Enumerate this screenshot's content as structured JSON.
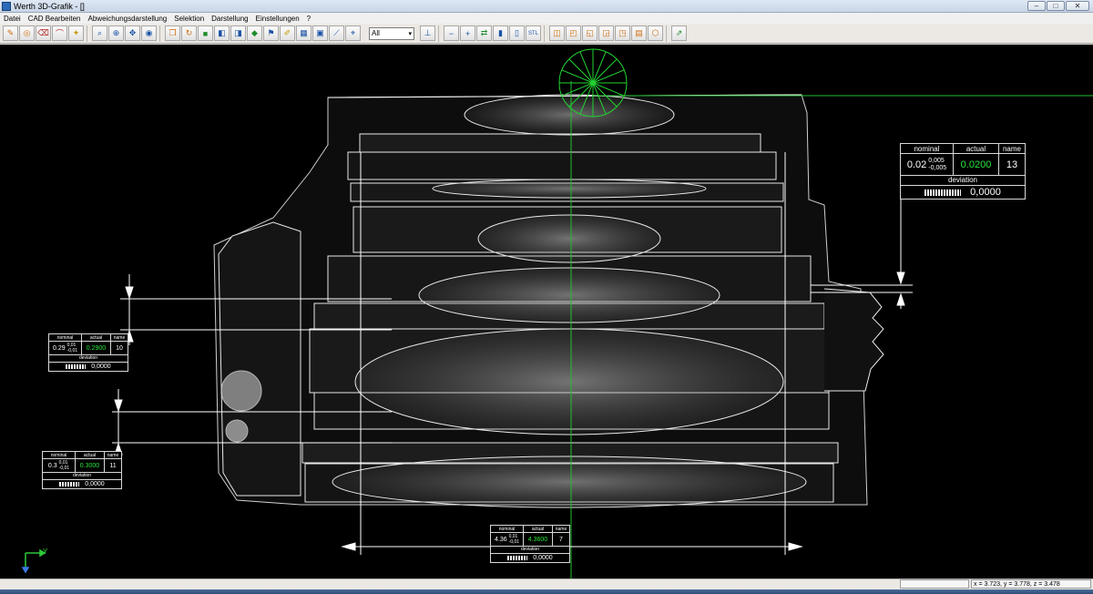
{
  "window": {
    "title": "Werth 3D-Grafik - []",
    "controls": {
      "minimize": "–",
      "maximize": "□",
      "close": "✕"
    }
  },
  "menu": [
    "Datei",
    "CAD Bearbeiten",
    "Abweichungsdarstellung",
    "Selektion",
    "Darstellung",
    "Einstellungen",
    "?"
  ],
  "toolbar": {
    "group1": [
      {
        "icon": "pencil-icon",
        "glyph": "✎"
      },
      {
        "icon": "cylinder-icon",
        "glyph": "◎"
      },
      {
        "icon": "eraser-icon",
        "glyph": "⌫"
      },
      {
        "icon": "arc-icon",
        "glyph": "⌒"
      },
      {
        "icon": "light-icon",
        "glyph": "✦"
      }
    ],
    "group2": [
      {
        "icon": "zoom-window-icon",
        "glyph": "⌕"
      },
      {
        "icon": "zoom-icon",
        "glyph": "⊕"
      },
      {
        "icon": "pan-icon",
        "glyph": "✥"
      },
      {
        "icon": "eye-icon",
        "glyph": "◉"
      }
    ],
    "group3": [
      {
        "icon": "cube-view-icon",
        "glyph": "❒"
      },
      {
        "icon": "rotate-icon",
        "glyph": "↻"
      },
      {
        "icon": "color-cube-icon",
        "glyph": "■"
      },
      {
        "icon": "section-icon",
        "glyph": "◧"
      },
      {
        "icon": "split-cube-icon",
        "glyph": "◨"
      },
      {
        "icon": "diamond-icon",
        "glyph": "◆"
      },
      {
        "icon": "flag-icon",
        "glyph": "⚑"
      },
      {
        "icon": "brush-icon",
        "glyph": "✐"
      },
      {
        "icon": "grid-icon",
        "glyph": "▦"
      },
      {
        "icon": "screen-icon",
        "glyph": "▣"
      },
      {
        "icon": "ruler-icon",
        "glyph": "⟋"
      },
      {
        "icon": "tag-icon",
        "glyph": "⌖"
      }
    ],
    "view_select": "All",
    "group4": [
      {
        "icon": "pin-icon",
        "glyph": "⊥"
      }
    ],
    "group5": [
      {
        "icon": "minus-icon",
        "glyph": "−"
      },
      {
        "icon": "plus-icon",
        "glyph": "+"
      },
      {
        "icon": "arrow-swap-icon",
        "glyph": "⇄"
      },
      {
        "icon": "stack-icon",
        "glyph": "▮"
      },
      {
        "icon": "layer-icon",
        "glyph": "▯"
      },
      {
        "icon": "stl-icon",
        "glyph": "STL"
      }
    ],
    "group6": [
      {
        "icon": "view-front-icon",
        "glyph": "◫"
      },
      {
        "icon": "view-top-icon",
        "glyph": "◰"
      },
      {
        "icon": "view-left-icon",
        "glyph": "◱"
      },
      {
        "icon": "view-right-icon",
        "glyph": "◲"
      },
      {
        "icon": "view-bottom-icon",
        "glyph": "◳"
      },
      {
        "icon": "view-back-icon",
        "glyph": "▤"
      },
      {
        "icon": "view-iso-icon",
        "glyph": "⬡"
      }
    ],
    "group7": [
      {
        "icon": "export-icon",
        "glyph": "⇗"
      }
    ]
  },
  "measurements": {
    "m13": {
      "nominal_hdr": "nominal",
      "actual_hdr": "actual",
      "name_hdr": "name",
      "nominal": "0.02",
      "tol_upper": "0,005",
      "tol_lower": "-0,005",
      "actual": "0.0200",
      "name": "13",
      "deviation_hdr": "deviation",
      "deviation": "0,0000"
    },
    "m10": {
      "nominal_hdr": "nominal",
      "actual_hdr": "actual",
      "name_hdr": "name",
      "nominal": "0.29",
      "tol_upper": "0,01",
      "tol_lower": "-0,01",
      "actual": "0.2900",
      "name": "10",
      "deviation_hdr": "deviation",
      "deviation": "0,0000"
    },
    "m11": {
      "nominal_hdr": "nominal",
      "actual_hdr": "actual",
      "name_hdr": "name",
      "nominal": "0.3",
      "tol_upper": "0,01",
      "tol_lower": "-0,01",
      "actual": "0.3000",
      "name": "11",
      "deviation_hdr": "deviation",
      "deviation": "0,0000"
    },
    "m7": {
      "nominal_hdr": "nominal",
      "actual_hdr": "actual",
      "name_hdr": "name",
      "nominal": "4.36",
      "tol_upper": "0,01",
      "tol_lower": "-0,01",
      "actual": "4.3600",
      "name": "7",
      "deviation_hdr": "deviation",
      "deviation": "0,0000"
    }
  },
  "axis": {
    "label": "Y"
  },
  "status": {
    "coords": "x = 3.723, y = 3.778, z = 3.478"
  },
  "colors": {
    "background": "#000000",
    "actual_value": "#28e43a",
    "guide_line": "#1fbf2f",
    "part_lines": "#e8e8e8"
  }
}
